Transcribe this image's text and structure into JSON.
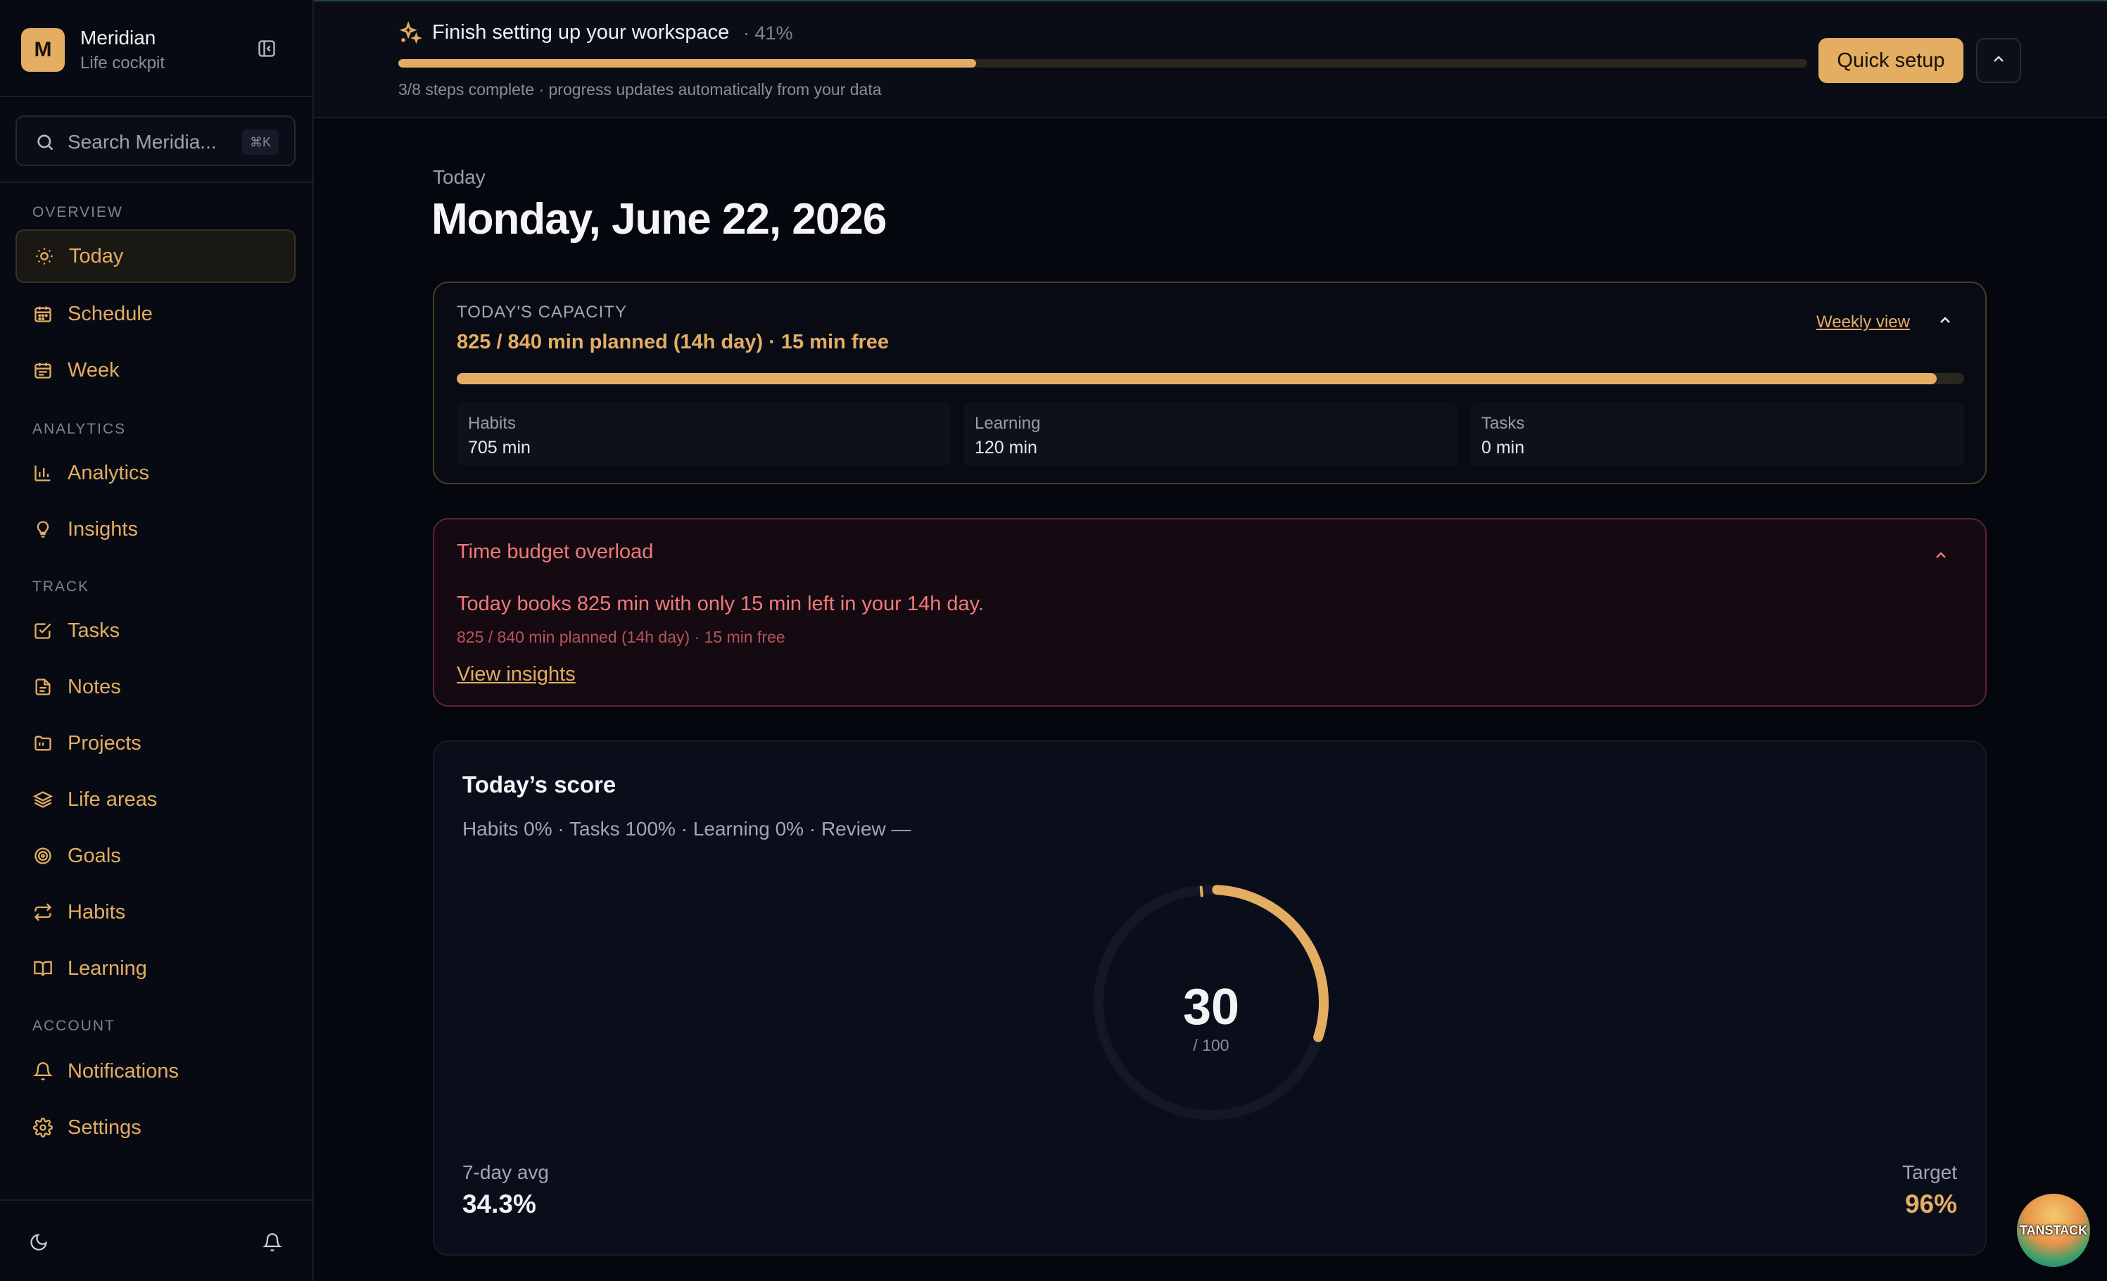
{
  "brand": {
    "initial": "M",
    "name": "Meridian",
    "subtitle": "Life cockpit"
  },
  "search": {
    "placeholder": "Search Meridia...",
    "shortcut": "⌘K"
  },
  "nav": {
    "sections": [
      {
        "title": "OVERVIEW",
        "items": [
          {
            "label": "Today",
            "icon": "sun-icon",
            "active": true
          },
          {
            "label": "Schedule",
            "icon": "calendar-icon"
          },
          {
            "label": "Week",
            "icon": "calendar-week-icon"
          }
        ]
      },
      {
        "title": "ANALYTICS",
        "items": [
          {
            "label": "Analytics",
            "icon": "bar-chart-icon"
          },
          {
            "label": "Insights",
            "icon": "lightbulb-icon"
          }
        ]
      },
      {
        "title": "TRACK",
        "items": [
          {
            "label": "Tasks",
            "icon": "checkbox-icon"
          },
          {
            "label": "Notes",
            "icon": "document-icon"
          },
          {
            "label": "Projects",
            "icon": "folder-icon"
          },
          {
            "label": "Life areas",
            "icon": "layers-icon"
          },
          {
            "label": "Goals",
            "icon": "target-icon"
          },
          {
            "label": "Habits",
            "icon": "repeat-icon"
          },
          {
            "label": "Learning",
            "icon": "book-icon"
          }
        ]
      },
      {
        "title": "ACCOUNT",
        "items": [
          {
            "label": "Notifications",
            "icon": "bell-icon"
          },
          {
            "label": "Settings",
            "icon": "gear-icon"
          }
        ]
      }
    ]
  },
  "banner": {
    "title": "Finish setting up your workspace",
    "percent_label": "· 41%",
    "progress": 0.41,
    "subtitle": "3/8 steps complete · progress updates automatically from your data",
    "cta": "Quick setup"
  },
  "page": {
    "eyebrow": "Today",
    "title": "Monday, June 22, 2026"
  },
  "capacity": {
    "label": "TODAY'S CAPACITY",
    "value": "825 / 840 min planned (14h day) · 15 min free",
    "weekly_link": "Weekly view",
    "progress": 0.982,
    "tiles": [
      {
        "label": "Habits",
        "value": "705 min"
      },
      {
        "label": "Learning",
        "value": "120 min"
      },
      {
        "label": "Tasks",
        "value": "0 min"
      }
    ]
  },
  "alert": {
    "title": "Time budget overload",
    "body": "Today books 825 min with only 15 min left in your 14h day.",
    "meta": "825 / 840 min planned (14h day) · 15 min free",
    "link": "View insights"
  },
  "score": {
    "title": "Today’s score",
    "breakdown": "Habits 0% · Tasks 100% · Learning 0% · Review —",
    "value": 30,
    "value_label": "30",
    "max_label": "/ 100",
    "avg_label": "7-day avg",
    "avg_value": "34.3%",
    "target_label": "Target",
    "target_value": "96%"
  },
  "badge": {
    "text": "TANSTACK"
  },
  "colors": {
    "accent": "#e3ad62",
    "danger": "#f07a7a",
    "bg": "#05070f"
  }
}
